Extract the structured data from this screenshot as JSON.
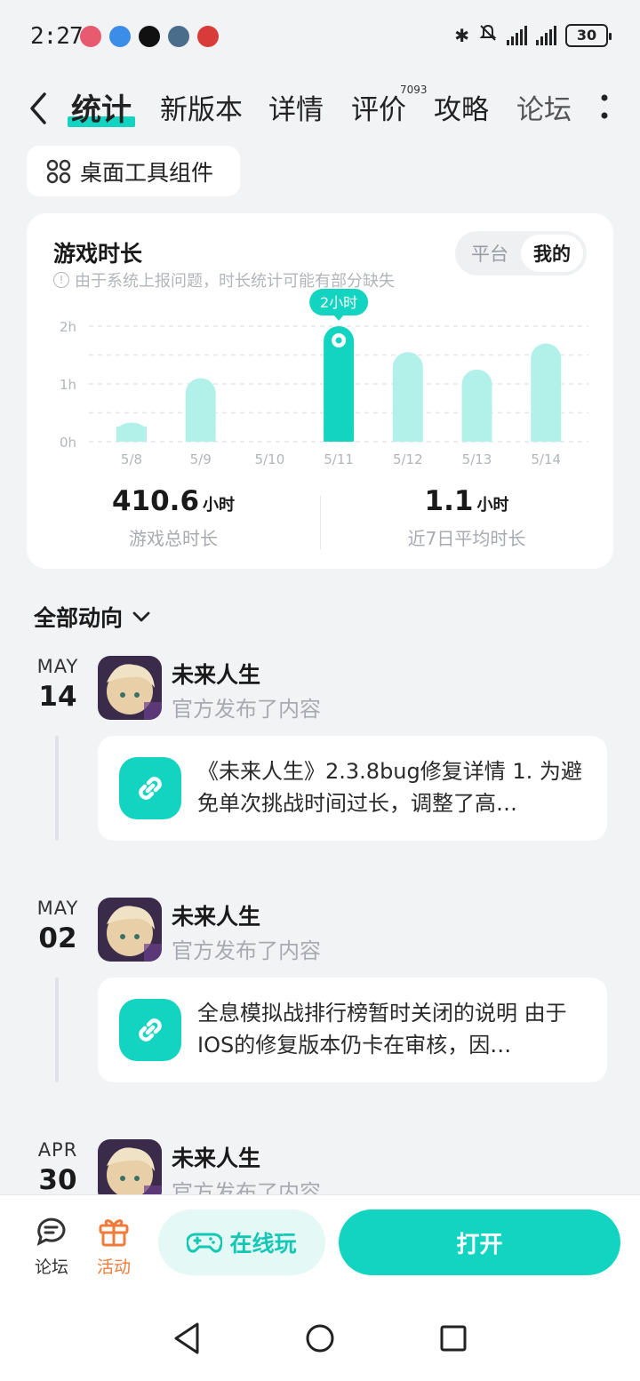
{
  "status_bar": {
    "time": "2:27",
    "battery": "30",
    "app_icon_colors": [
      "#e85a6f",
      "#3b8de8",
      "#111111",
      "#4a6d8c",
      "#d93a3a"
    ]
  },
  "nav": {
    "tabs": [
      {
        "label": "统计",
        "active": true
      },
      {
        "label": "新版本"
      },
      {
        "label": "详情"
      },
      {
        "label": "评价",
        "badge": "7093"
      },
      {
        "label": "攻略"
      },
      {
        "label": "论坛"
      }
    ]
  },
  "widget_chip": {
    "label": "桌面工具组件",
    "icon": "grid-icon"
  },
  "stats": {
    "title": "游戏时长",
    "note": "由于系统上报问题，时长统计可能有部分缺失",
    "segment": {
      "options": [
        "平台",
        "我的"
      ],
      "selected": "我的"
    },
    "total": {
      "value": "410.6",
      "unit": "小时",
      "label": "游戏总时长"
    },
    "average": {
      "value": "1.1",
      "unit": "小时",
      "label": "近7日平均时长"
    }
  },
  "chart_data": {
    "type": "bar",
    "categories": [
      "5/8",
      "5/9",
      "5/10",
      "5/11",
      "5/12",
      "5/13",
      "5/14"
    ],
    "values": [
      0.33,
      1.1,
      0,
      2.0,
      1.55,
      1.25,
      1.7
    ],
    "y_ticks": [
      "0h",
      "1h",
      "2h"
    ],
    "ylim": [
      0,
      2.1
    ],
    "highlight_index": 3,
    "highlight_label": "2小时",
    "bar_color": "#b2f1ea",
    "highlight_color": "#12d4c0",
    "grid": true
  },
  "feed": {
    "header": "全部动向",
    "items": [
      {
        "month": "MAY",
        "day": "14",
        "game": "未来人生",
        "action": "官方发布了内容",
        "text": "《未来人生》2.3.8bug修复详情 1. 为避免单次挑战时间过长，调整了高…"
      },
      {
        "month": "MAY",
        "day": "02",
        "game": "未来人生",
        "action": "官方发布了内容",
        "text": "全息模拟战排行榜暂时关闭的说明 由于IOS的修复版本仍卡在审核，因…"
      },
      {
        "month": "APR",
        "day": "30",
        "game": "未来人生",
        "action": "官方发布了内容",
        "text": ""
      }
    ]
  },
  "bottom_bar": {
    "forum_label": "论坛",
    "activity_label": "活动",
    "online_label": "在线玩",
    "open_label": "打开",
    "accent": "#12d4c0",
    "activity_color": "#f07a3a"
  }
}
